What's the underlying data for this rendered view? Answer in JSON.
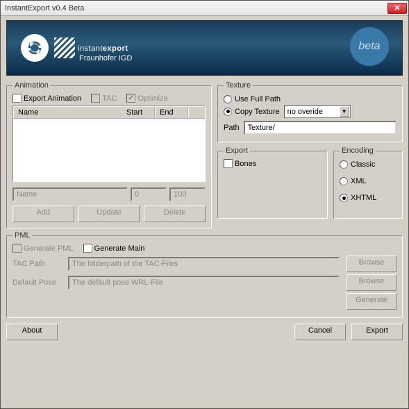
{
  "window": {
    "title": "InstantExport v0.4 Beta"
  },
  "banner": {
    "title_light": "instant",
    "title_bold": "export",
    "subtitle": "Fraunhofer IGD",
    "badge": "beta"
  },
  "animation": {
    "legend": "Animation",
    "export_label": "Export Animation",
    "tac_label": "TAC",
    "optimize_label": "Optimize",
    "optimize_checked": "✓",
    "col_name": "Name",
    "col_start": "Start",
    "col_end": "End",
    "name_placeholder": "Name",
    "start_value": "0",
    "end_value": "100",
    "btn_add": "Add",
    "btn_update": "Update",
    "btn_delete": "Delete"
  },
  "texture": {
    "legend": "Texture",
    "use_full_path": "Use Full Path",
    "copy_texture": "Copy Texture",
    "override_value": "no overide",
    "path_label": "Path",
    "path_value": "Texture/"
  },
  "export": {
    "legend": "Export",
    "bones": "Bones"
  },
  "encoding": {
    "legend": "Encoding",
    "classic": "Classic",
    "xml": "XML",
    "xhtml": "XHTML"
  },
  "pml": {
    "legend": "PML",
    "generate_pml": "Generate PML",
    "generate_main": "Generate Main",
    "tac_path_label": "TAC Path",
    "tac_path_value": "The folderpath of the TAC-Files",
    "default_pose_label": "Default Pose",
    "default_pose_value": "The default pose WRL-File",
    "browse": "Browse",
    "generate": "Generate"
  },
  "footer": {
    "about": "About",
    "cancel": "Cancel",
    "export": "Export"
  }
}
